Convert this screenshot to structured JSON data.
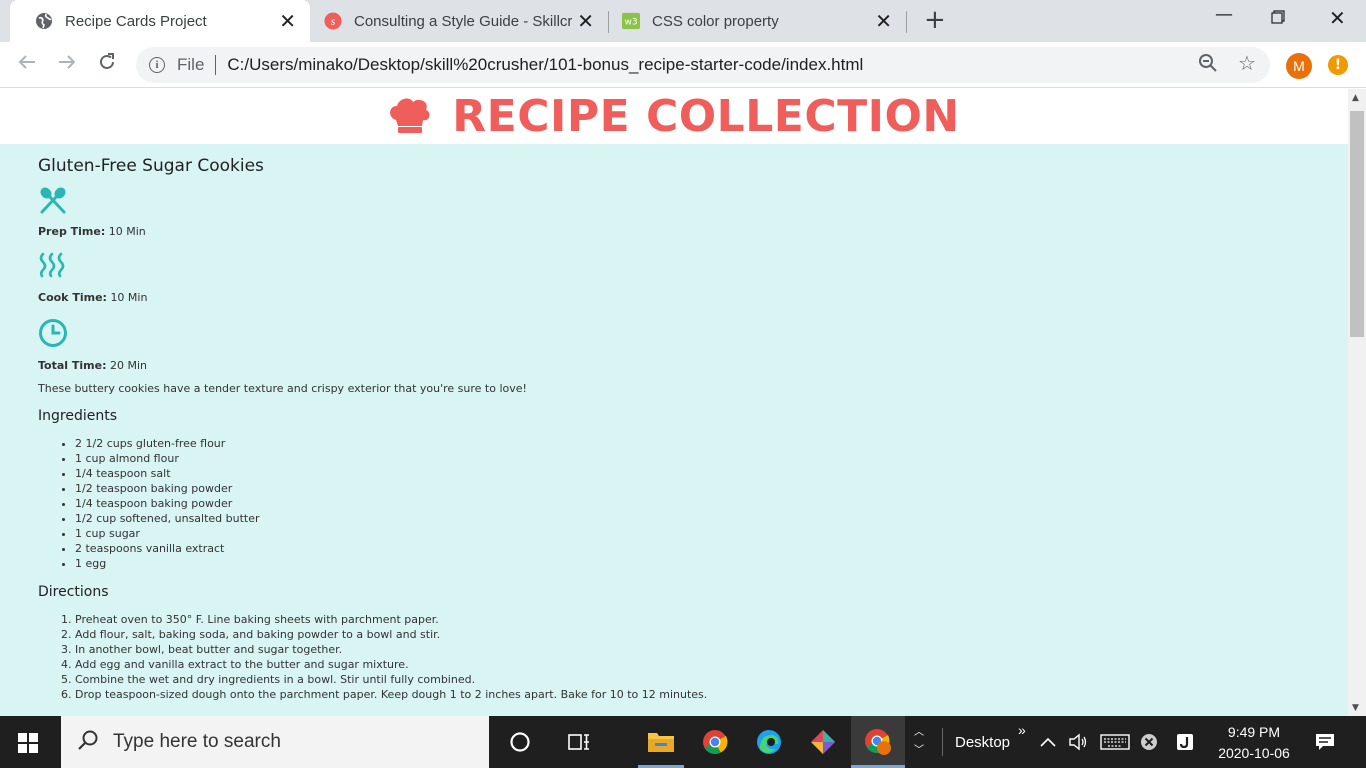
{
  "browser": {
    "tabs": [
      {
        "title": "Recipe Cards Project",
        "favicon": "globe-icon",
        "active": true
      },
      {
        "title": "Consulting a Style Guide - Skillcru",
        "favicon": "skillcrush-icon",
        "active": false
      },
      {
        "title": "CSS color property",
        "favicon": "w3schools-icon",
        "active": false
      }
    ],
    "url_scheme": "File",
    "url": "C:/Users/minako/Desktop/skill%20crusher/101-bonus_recipe-starter-code/index.html",
    "profile_initial": "M",
    "alert_symbol": "!"
  },
  "page": {
    "site_title": "RECIPE COLLECTION",
    "recipe": {
      "name": "Gluten-Free Sugar Cookies",
      "prep_label": "Prep Time:",
      "prep_value": "10 Min",
      "cook_label": "Cook Time:",
      "cook_value": "10 Min",
      "total_label": "Total Time:",
      "total_value": "20 Min",
      "description": "These buttery cookies have a tender texture and crispy exterior that you're sure to love!",
      "ingredients_heading": "Ingredients",
      "ingredients": [
        "2 1/2 cups gluten-free flour",
        "1 cup almond flour",
        "1/4 teaspoon salt",
        "1/2 teaspoon baking powder",
        "1/4 teaspoon baking powder",
        "1/2 cup softened, unsalted butter",
        "1 cup sugar",
        "2 teaspoons vanilla extract",
        "1 egg"
      ],
      "directions_heading": "Directions",
      "directions": [
        "Preheat oven to 350° F. Line baking sheets with parchment paper.",
        "Add flour, salt, baking soda, and baking powder to a bowl and stir.",
        "In another bowl, beat butter and sugar together.",
        "Add egg and vanilla extract to the butter and sugar mixture.",
        "Combine the wet and dry ingredients in a bowl. Stir until fully combined.",
        "Drop teaspoon-sized dough onto the parchment paper. Keep dough 1 to 2 inches apart. Bake for 10 to 12 minutes."
      ]
    }
  },
  "colors": {
    "accent": "#ef5e5a",
    "card_bg": "#d8f4f3",
    "icon_teal": "#2ab7b3"
  },
  "taskbar": {
    "search_placeholder": "Type here to search",
    "desktop_label": "Desktop",
    "time": "9:49 PM",
    "date": "2020-10-06"
  }
}
